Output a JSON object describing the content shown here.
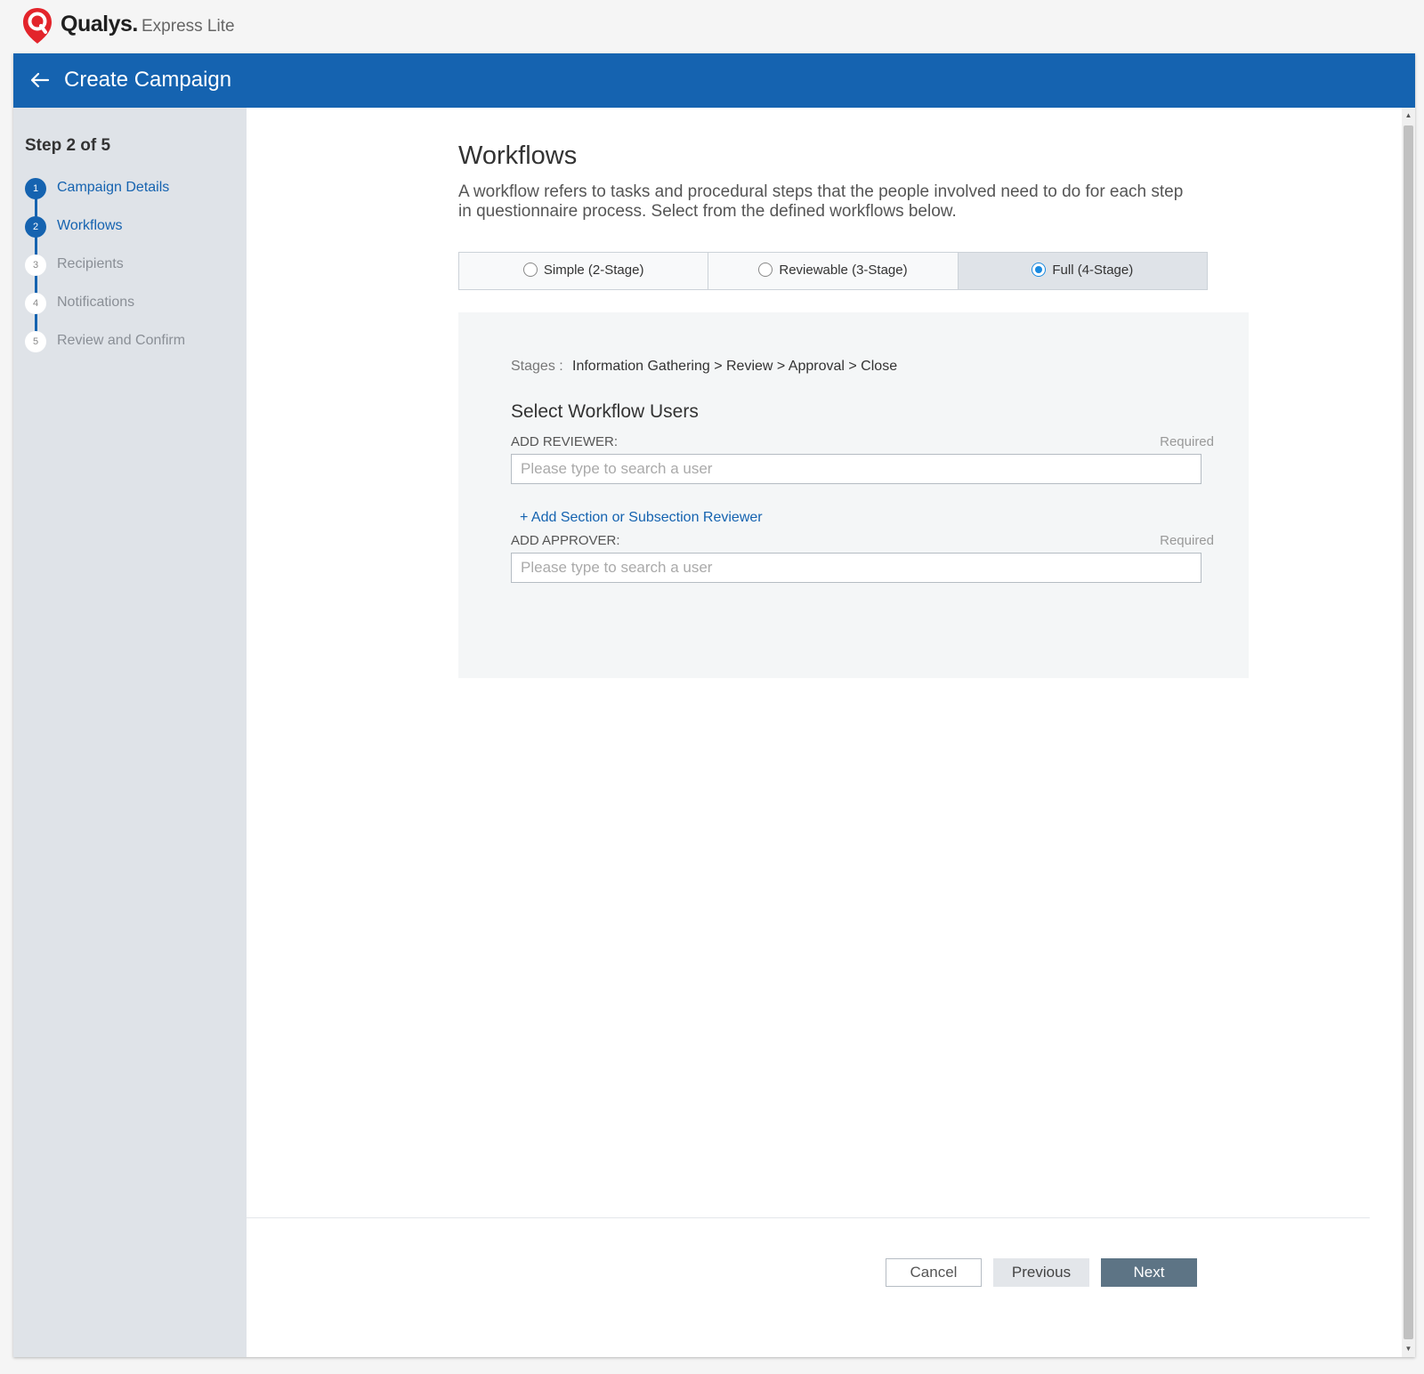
{
  "brand": {
    "name": "Qualys.",
    "product": "Express Lite"
  },
  "header": {
    "title": "Create Campaign",
    "back_icon": "arrow-left-icon"
  },
  "sidebar": {
    "step_progress": "Step 2 of 5",
    "steps": [
      {
        "num": "1",
        "label": "Campaign Details",
        "state": "done"
      },
      {
        "num": "2",
        "label": "Workflows",
        "state": "current"
      },
      {
        "num": "3",
        "label": "Recipients",
        "state": "todo"
      },
      {
        "num": "4",
        "label": "Notifications",
        "state": "todo"
      },
      {
        "num": "5",
        "label": "Review and Confirm",
        "state": "todo"
      }
    ]
  },
  "main": {
    "title": "Workflows",
    "description": "A workflow refers to tasks and procedural steps that the people involved need to do for each step in questionnaire process. Select from the defined workflows below.",
    "workflow_options": [
      {
        "label": "Simple (2-Stage)",
        "selected": false
      },
      {
        "label": "Reviewable (3-Stage)",
        "selected": false
      },
      {
        "label": "Full (4-Stage)",
        "selected": true
      }
    ],
    "stages_label": "Stages :",
    "stages_value": "Information Gathering > Review > Approval > Close",
    "users_heading": "Select Workflow Users",
    "reviewer": {
      "label": "ADD REVIEWER:",
      "required": "Required",
      "placeholder": "Please type to search a user",
      "value": ""
    },
    "add_section_link": "+ Add Section or Subsection Reviewer",
    "approver": {
      "label": "ADD APPROVER:",
      "required": "Required",
      "placeholder": "Please type to search a user",
      "value": ""
    }
  },
  "footer": {
    "cancel": "Cancel",
    "previous": "Previous",
    "next": "Next"
  },
  "colors": {
    "primary": "#1563b0",
    "sidebar_bg": "#dfe3e8",
    "next_button": "#5d7485",
    "radio_selected": "#1a8ae0"
  }
}
